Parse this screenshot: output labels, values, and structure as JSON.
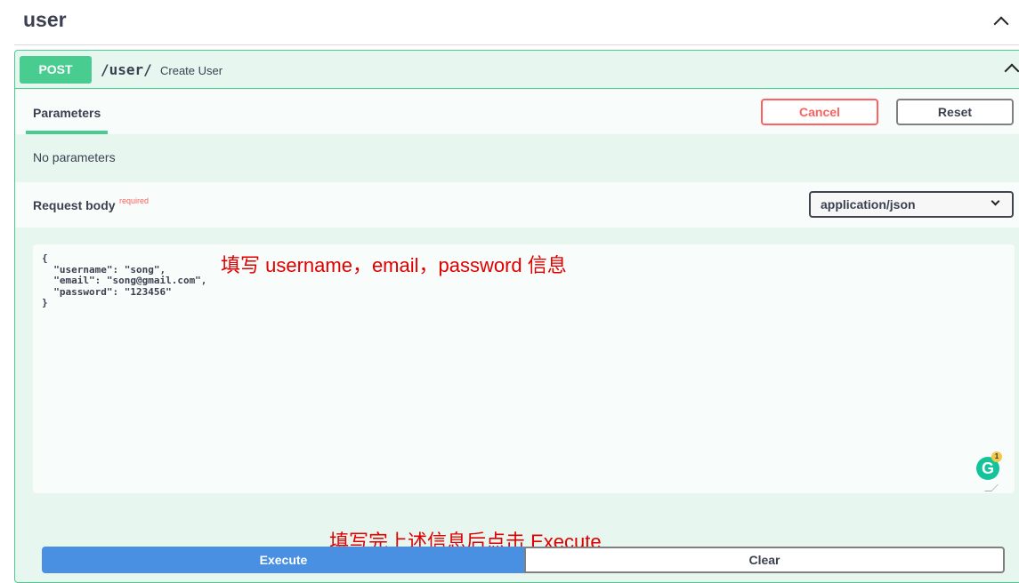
{
  "tag": {
    "title": "user"
  },
  "operation": {
    "method": "POST",
    "path": "/user/",
    "summary": "Create User"
  },
  "parameters": {
    "tab_label": "Parameters",
    "cancel_label": "Cancel",
    "reset_label": "Reset",
    "empty_text": "No parameters"
  },
  "request_body": {
    "label": "Request body",
    "required_label": "required",
    "content_type": "application/json",
    "json_text": "{\n  \"username\": \"song\",\n  \"email\": \"song@gmail.com\",\n  \"password\": \"123456\"\n}"
  },
  "annotations": {
    "fill_info": "填写 username，email，password 信息",
    "then_execute": "填写完上述信息后点击 Execute"
  },
  "grammarly": {
    "count": "1",
    "letter": "G"
  },
  "actions": {
    "execute_label": "Execute",
    "clear_label": "Clear"
  },
  "colors": {
    "post_accent": "#49cc90",
    "execute_blue": "#4990e2",
    "cancel_red": "#ff6060",
    "annotation_red": "#e00000"
  }
}
